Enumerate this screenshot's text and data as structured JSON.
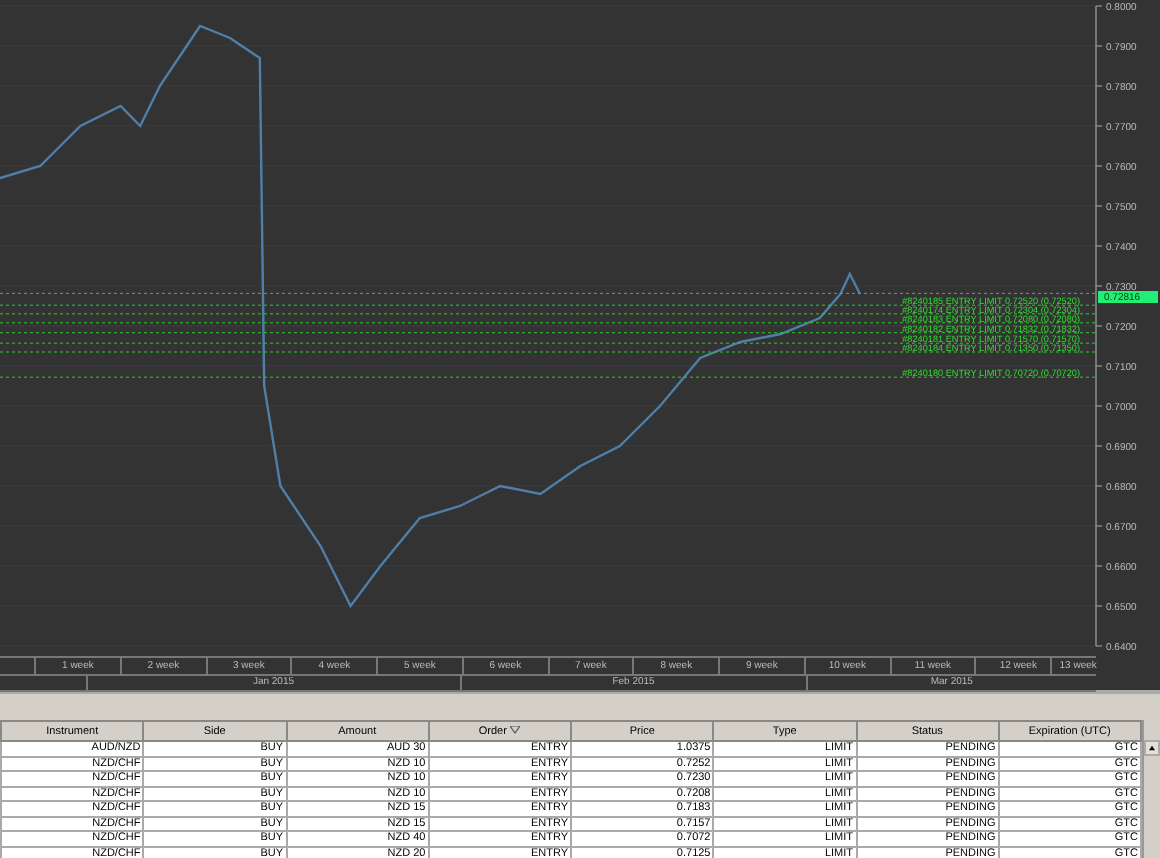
{
  "chart": {
    "chart_data": {
      "type": "line",
      "x": [
        0.6,
        1.07,
        1.54,
        2.01,
        2.24,
        2.47,
        2.94,
        3.29,
        3.64,
        3.69,
        3.88,
        4.35,
        4.7,
        5.05,
        5.51,
        5.98,
        6.45,
        6.92,
        7.39,
        7.85,
        8.32,
        8.79,
        9.26,
        9.73,
        10.19,
        10.43,
        10.54,
        10.66
      ],
      "series": [
        {
          "color": "#4f7fa8",
          "values": [
            0.757,
            0.76,
            0.77,
            0.775,
            0.77,
            0.78,
            0.795,
            0.792,
            0.787,
            0.705,
            0.68,
            0.665,
            0.65,
            0.66,
            0.672,
            0.675,
            0.68,
            0.678,
            0.685,
            0.69,
            0.7,
            0.712,
            0.716,
            0.718,
            0.722,
            0.728,
            0.733,
            0.728
          ]
        }
      ],
      "xlim": [
        0.6,
        13.42
      ],
      "ylim": [
        0.64,
        0.8
      ],
      "xticks": [
        {
          "value": 1.5,
          "label": "1 week"
        },
        {
          "value": 2.5,
          "label": "2 week"
        },
        {
          "value": 3.5,
          "label": "3 week"
        },
        {
          "value": 4.5,
          "label": "4 week"
        },
        {
          "value": 5.5,
          "label": "5 week"
        },
        {
          "value": 6.5,
          "label": "6 week"
        },
        {
          "value": 7.5,
          "label": "7 week"
        },
        {
          "value": 8.5,
          "label": "8 week"
        },
        {
          "value": 9.5,
          "label": "9 week"
        },
        {
          "value": 10.5,
          "label": "10 week"
        },
        {
          "value": 11.5,
          "label": "11 week"
        },
        {
          "value": 12.5,
          "label": "12 week"
        },
        {
          "value": 13.2,
          "label": "13 week"
        }
      ],
      "yticks": [
        {
          "value": 0.8,
          "label": "0.8000"
        },
        {
          "value": 0.79,
          "label": "0.7900"
        },
        {
          "value": 0.78,
          "label": "0.7800"
        },
        {
          "value": 0.77,
          "label": "0.7700"
        },
        {
          "value": 0.76,
          "label": "0.7600"
        },
        {
          "value": 0.75,
          "label": "0.7500"
        },
        {
          "value": 0.74,
          "label": "0.7400"
        },
        {
          "value": 0.73,
          "label": "0.7300"
        },
        {
          "value": 0.72,
          "label": "0.7200"
        },
        {
          "value": 0.71,
          "label": "0.7100"
        },
        {
          "value": 0.7,
          "label": "0.7000"
        },
        {
          "value": 0.69,
          "label": "0.6900"
        },
        {
          "value": 0.68,
          "label": "0.6800"
        },
        {
          "value": 0.67,
          "label": "0.6700"
        },
        {
          "value": 0.66,
          "label": "0.6600"
        },
        {
          "value": 0.65,
          "label": "0.6500"
        },
        {
          "value": 0.64,
          "label": "0.6400"
        }
      ],
      "annotations": [
        "0.72816"
      ],
      "ref_lines": [
        {
          "axis": "y",
          "value": 0.72816,
          "color": "#888888"
        },
        {
          "axis": "y",
          "value": 0.7252,
          "color": "#2ecc2e",
          "label": "#8240185 ENTRY LIMIT 0.72520 (0.72520)"
        },
        {
          "axis": "y",
          "value": 0.72304,
          "color": "#2ecc2e",
          "label": "#8240174 ENTRY LIMIT 0.72304 (0.72304)"
        },
        {
          "axis": "y",
          "value": 0.7208,
          "color": "#2ecc2e",
          "label": "#8240183 ENTRY LIMIT 0.72080 (0.72080)"
        },
        {
          "axis": "y",
          "value": 0.71832,
          "color": "#2ecc2e",
          "label": "#8240182 ENTRY LIMIT 0.71832 (0.71832)"
        },
        {
          "axis": "y",
          "value": 0.7157,
          "color": "#2ecc2e",
          "label": "#8240181 ENTRY LIMIT 0.71570 (0.71570)"
        },
        {
          "axis": "y",
          "value": 0.7135,
          "color": "#2ecc2e",
          "label": "#8240184 ENTRY LIMIT 0.71350 (0.71350)"
        },
        {
          "axis": "y",
          "value": 0.7072,
          "color": "#2ecc2e",
          "label": "#8240180 ENTRY LIMIT 0.70720 (0.70720)"
        }
      ]
    },
    "months": [
      "Jan 2015",
      "Feb 2015",
      "Mar 2015"
    ]
  },
  "table": {
    "columns": [
      {
        "label": "Instrument"
      },
      {
        "label": "Side"
      },
      {
        "label": "Amount"
      },
      {
        "label": "Order",
        "sorted": true
      },
      {
        "label": "Price"
      },
      {
        "label": "Type"
      },
      {
        "label": "Status"
      },
      {
        "label": "Expiration (UTC)"
      }
    ],
    "rows": [
      [
        "AUD/NZD",
        "BUY",
        "AUD 30",
        "ENTRY",
        "1.0375",
        "LIMIT",
        "PENDING",
        "GTC"
      ],
      [
        "NZD/CHF",
        "BUY",
        "NZD 10",
        "ENTRY",
        "0.7252",
        "LIMIT",
        "PENDING",
        "GTC"
      ],
      [
        "NZD/CHF",
        "BUY",
        "NZD 10",
        "ENTRY",
        "0.7230",
        "LIMIT",
        "PENDING",
        "GTC"
      ],
      [
        "NZD/CHF",
        "BUY",
        "NZD 10",
        "ENTRY",
        "0.7208",
        "LIMIT",
        "PENDING",
        "GTC"
      ],
      [
        "NZD/CHF",
        "BUY",
        "NZD 15",
        "ENTRY",
        "0.7183",
        "LIMIT",
        "PENDING",
        "GTC"
      ],
      [
        "NZD/CHF",
        "BUY",
        "NZD 15",
        "ENTRY",
        "0.7157",
        "LIMIT",
        "PENDING",
        "GTC"
      ],
      [
        "NZD/CHF",
        "BUY",
        "NZD 40",
        "ENTRY",
        "0.7072",
        "LIMIT",
        "PENDING",
        "GTC"
      ],
      [
        "NZD/CHF",
        "BUY",
        "NZD 20",
        "ENTRY",
        "0.7125",
        "LIMIT",
        "PENDING",
        "GTC"
      ]
    ]
  }
}
